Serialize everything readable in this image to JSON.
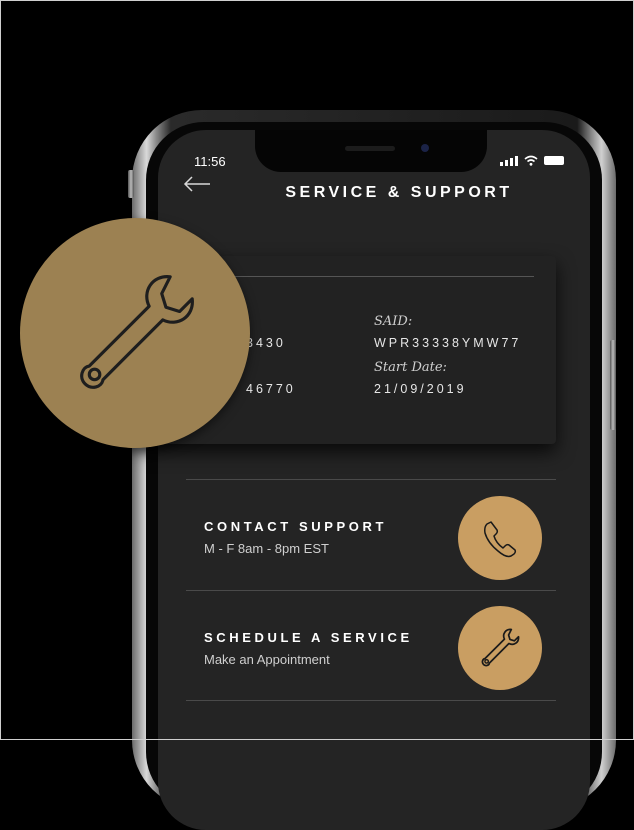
{
  "status_bar": {
    "time": "11:56"
  },
  "header": {
    "title": "SERVICE & SUPPORT"
  },
  "card": {
    "left_value_1": "3430",
    "left_value_2": "46770",
    "said_label": "SAID:",
    "said_value": "WPR33338YMW77",
    "start_date_label": "Start Date:",
    "start_date_value": "21/09/2019"
  },
  "list": [
    {
      "title": "CONTACT SUPPORT",
      "subtitle": "M - F 8am - 8pm EST",
      "icon": "phone-icon"
    },
    {
      "title": "SCHEDULE A SERVICE",
      "subtitle": "Make an Appointment",
      "icon": "wrench-icon"
    }
  ],
  "badge": {
    "icon": "wrench-icon"
  },
  "colors": {
    "accent": "#c99e62",
    "badge": "#9c8152",
    "screen": "#242424",
    "background": "#000000"
  }
}
